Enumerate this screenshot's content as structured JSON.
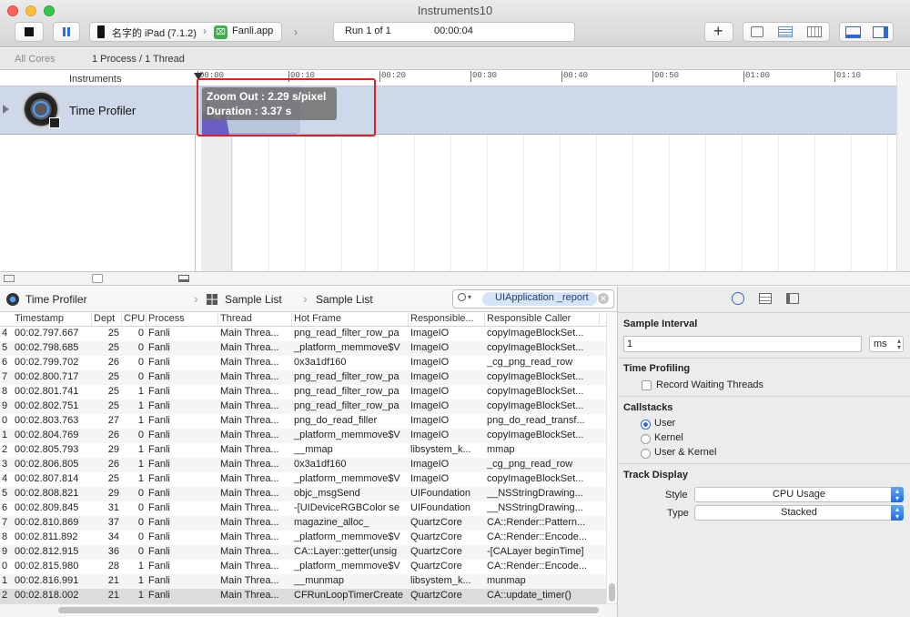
{
  "window": {
    "title": "Instruments10"
  },
  "toolbar": {
    "device": "名字的 iPad (7.1.2)",
    "target": "Fanli.app",
    "run": "Run 1 of 1",
    "elapsed": "00:00:04",
    "add": "+"
  },
  "strategy": {
    "all_cores": "All Cores",
    "scope": "1 Process / 1 Thread"
  },
  "tracks": {
    "header": "Instruments",
    "items": [
      {
        "name": "Time Profiler"
      }
    ]
  },
  "ruler": {
    "ticks": [
      "00:00",
      "00:10",
      "00:20",
      "00:30",
      "00:40",
      "00:50",
      "01:00",
      "01:10"
    ]
  },
  "tooltip": {
    "line1": "Zoom Out : 2.29 s/pixel",
    "line2": "Duration : 3.37 s"
  },
  "jumpbar": {
    "instrument": "Time Profiler",
    "view": "Sample List",
    "sub": "Sample List",
    "search": "UIApplication _report"
  },
  "table": {
    "columns": [
      "Timestamp",
      "Dept",
      "CPU",
      "Process",
      "Thread",
      "Hot Frame",
      "Responsible...",
      "Responsible Caller"
    ],
    "rows": [
      [
        "4",
        "00:02.797.667",
        "25",
        "0",
        "Fanli",
        "Main Threa...",
        "png_read_filter_row_pa",
        "ImageIO",
        "copyImageBlockSet..."
      ],
      [
        "5",
        "00:02.798.685",
        "25",
        "0",
        "Fanli",
        "Main Threa...",
        "_platform_memmove$V",
        "ImageIO",
        "copyImageBlockSet..."
      ],
      [
        "6",
        "00:02.799.702",
        "26",
        "0",
        "Fanli",
        "Main Threa...",
        "0x3a1df160",
        "ImageIO",
        "_cg_png_read_row"
      ],
      [
        "7",
        "00:02.800.717",
        "25",
        "0",
        "Fanli",
        "Main Threa...",
        "png_read_filter_row_pa",
        "ImageIO",
        "copyImageBlockSet..."
      ],
      [
        "8",
        "00:02.801.741",
        "25",
        "1",
        "Fanli",
        "Main Threa...",
        "png_read_filter_row_pa",
        "ImageIO",
        "copyImageBlockSet..."
      ],
      [
        "9",
        "00:02.802.751",
        "25",
        "1",
        "Fanli",
        "Main Threa...",
        "png_read_filter_row_pa",
        "ImageIO",
        "copyImageBlockSet..."
      ],
      [
        "0",
        "00:02.803.763",
        "27",
        "1",
        "Fanli",
        "Main Threa...",
        "png_do_read_filler",
        "ImageIO",
        "png_do_read_transf..."
      ],
      [
        "1",
        "00:02.804.769",
        "26",
        "0",
        "Fanli",
        "Main Threa...",
        "_platform_memmove$V",
        "ImageIO",
        "copyImageBlockSet..."
      ],
      [
        "2",
        "00:02.805.793",
        "29",
        "1",
        "Fanli",
        "Main Threa...",
        "__mmap",
        "libsystem_k...",
        "mmap"
      ],
      [
        "3",
        "00:02.806.805",
        "26",
        "1",
        "Fanli",
        "Main Threa...",
        "0x3a1df160",
        "ImageIO",
        "_cg_png_read_row"
      ],
      [
        "4",
        "00:02.807.814",
        "25",
        "1",
        "Fanli",
        "Main Threa...",
        "_platform_memmove$V",
        "ImageIO",
        "copyImageBlockSet..."
      ],
      [
        "5",
        "00:02.808.821",
        "29",
        "0",
        "Fanli",
        "Main Threa...",
        "objc_msgSend",
        "UIFoundation",
        "__NSStringDrawing..."
      ],
      [
        "6",
        "00:02.809.845",
        "31",
        "0",
        "Fanli",
        "Main Threa...",
        "-[UIDeviceRGBColor se",
        "UIFoundation",
        "__NSStringDrawing..."
      ],
      [
        "7",
        "00:02.810.869",
        "37",
        "0",
        "Fanli",
        "Main Threa...",
        "magazine_alloc_",
        "QuartzCore",
        "CA::Render::Pattern..."
      ],
      [
        "8",
        "00:02.811.892",
        "34",
        "0",
        "Fanli",
        "Main Threa...",
        "_platform_memmove$V",
        "QuartzCore",
        "CA::Render::Encode..."
      ],
      [
        "9",
        "00:02.812.915",
        "36",
        "0",
        "Fanli",
        "Main Threa...",
        "CA::Layer::getter(unsig",
        "QuartzCore",
        "-[CALayer beginTime]"
      ],
      [
        "0",
        "00:02.815.980",
        "28",
        "1",
        "Fanli",
        "Main Threa...",
        "_platform_memmove$V",
        "QuartzCore",
        "CA::Render::Encode..."
      ],
      [
        "1",
        "00:02.816.991",
        "21",
        "1",
        "Fanli",
        "Main Threa...",
        "__munmap",
        "libsystem_k...",
        "munmap"
      ],
      [
        "2",
        "00:02.818.002",
        "21",
        "1",
        "Fanli",
        "Main Threa...",
        "CFRunLoopTimerCreate",
        "QuartzCore",
        "CA::update_timer()"
      ]
    ]
  },
  "inspector": {
    "sample_interval": {
      "label": "Sample Interval",
      "value": "1",
      "unit": "ms"
    },
    "time_profiling": {
      "label": "Time Profiling",
      "record_waiting": "Record Waiting Threads"
    },
    "callstacks": {
      "label": "Callstacks",
      "options": [
        "User",
        "Kernel",
        "User & Kernel"
      ],
      "selected": "User"
    },
    "track_display": {
      "label": "Track Display",
      "style_label": "Style",
      "style_value": "CPU Usage",
      "type_label": "Type",
      "type_value": "Stacked"
    }
  },
  "colors": {
    "accent": "#1d6ee6",
    "track_bg": "#cdd9e8",
    "highlight": "#e02020",
    "cpu_graph": "#6a5fc4"
  }
}
